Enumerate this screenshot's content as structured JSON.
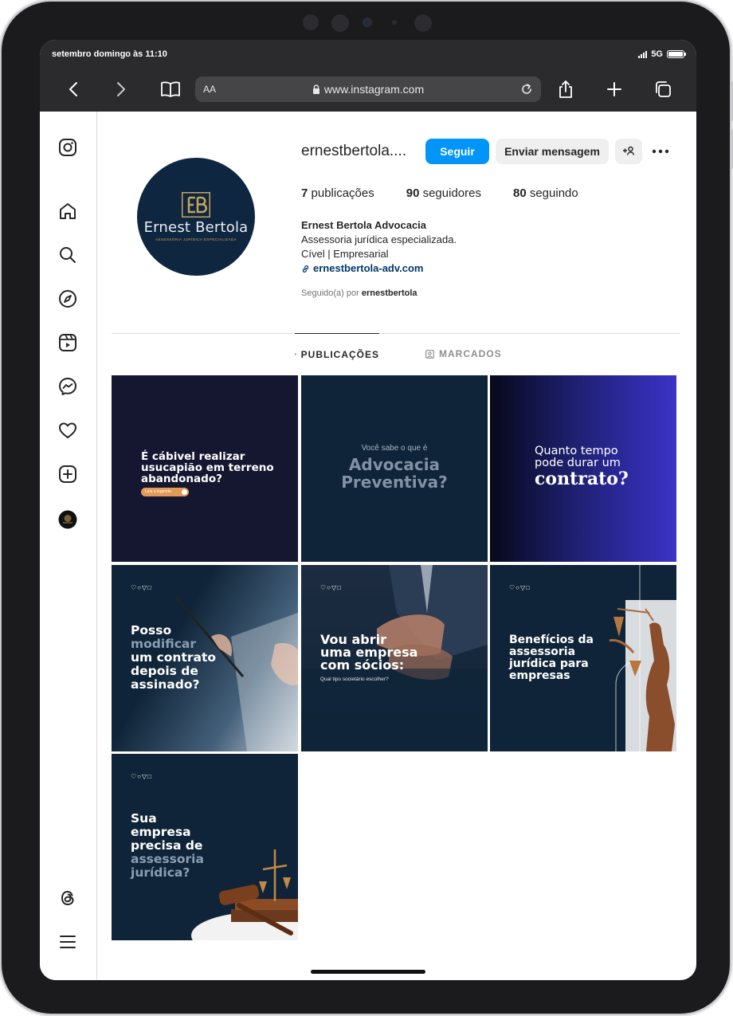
{
  "status_bar": {
    "time": "setembro domingo às 11:10",
    "network": "5G"
  },
  "browser": {
    "text_size_label": "AA",
    "url": "www.instagram.com"
  },
  "profile": {
    "username": "ernestbertola....",
    "follow_label": "Seguir",
    "message_label": "Enviar mensagem",
    "avatar_logo": {
      "name": "Ernest Bertola",
      "tagline": "ASSESSORIA JURÍDICA ESPECIALIZADA",
      "monogram": "EB"
    },
    "stats": {
      "posts_count": "7",
      "posts_label": "publicações",
      "followers_count": "90",
      "followers_label": "seguidores",
      "following_count": "80",
      "following_label": "seguindo"
    },
    "bio": {
      "name": "Ernest Bertola Advocacia",
      "line1": "Assessoria jurídica especializada.",
      "line2": "Cível | Empresarial",
      "link": "ernestbertola-adv.com"
    },
    "followed_by_prefix": "Seguido(a) por",
    "followed_by_user": "ernestbertola"
  },
  "tabs": {
    "posts": "PUBLICAÇÕES",
    "tagged": "MARCADOS"
  },
  "posts": [
    {
      "line1": "É cábivel realizar",
      "line2": "usucapião em terreno",
      "line3": "abandonado?",
      "badge": "Leia a legenda"
    },
    {
      "pre": "Você sabe o que é",
      "line1": "Advocacia",
      "line2": "Preventiva?"
    },
    {
      "line1": "Quanto tempo",
      "line2": "pode durar um",
      "line3": "contrato?"
    },
    {
      "line1": "Posso",
      "line2": "modificar",
      "line3": "um contrato",
      "line4": "depois de",
      "line5": "assinado?"
    },
    {
      "line1": "Vou abrir",
      "line2": "uma empresa",
      "line3": "com sócios:",
      "sub": "Qual tipo societário escolher?"
    },
    {
      "line1": "Benefícios da",
      "line2": "assessoria",
      "line3": "jurídica para",
      "line4": "empresas"
    },
    {
      "line1": "Sua",
      "line2": "empresa",
      "line3": "precisa de",
      "line4": "assessoria",
      "line5": "jurídica?"
    }
  ],
  "colors": {
    "instagram_blue": "#0095f6",
    "navy": "#0f2640",
    "gold": "#c9a25a"
  }
}
